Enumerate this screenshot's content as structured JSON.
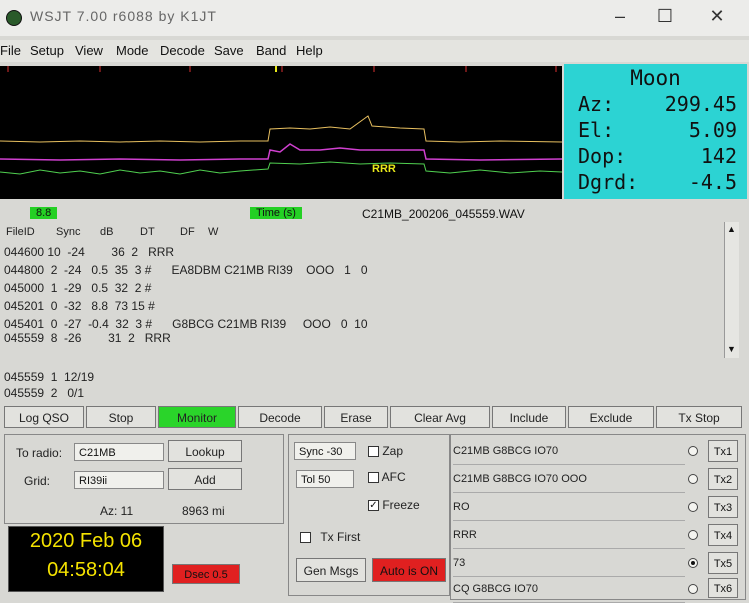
{
  "window": {
    "title": "WSJT 7.00 r6088  by K1JT",
    "buttons": [
      "–",
      "☐",
      "✕"
    ]
  },
  "menu": [
    "File",
    "Setup",
    "View",
    "Mode",
    "Decode",
    "Save",
    "Band",
    "Help"
  ],
  "waterfall": {
    "marker_text": "RRR"
  },
  "moon": {
    "title": "Moon",
    "rows": [
      {
        "label": "Az:",
        "value": "299.45"
      },
      {
        "label": "El:",
        "value": "5.09"
      },
      {
        "label": "Dop:",
        "value": "142"
      },
      {
        "label": "Dgrd:",
        "value": "-4.5"
      }
    ]
  },
  "strip": {
    "left_badge": "8.8",
    "center_badge": "Time (s)",
    "filename": "C21MB_200206_045559.WAV"
  },
  "decode": {
    "headers": [
      "FileID",
      "Sync",
      "dB",
      "DT",
      "DF",
      "W"
    ],
    "rows": [
      "044600 10  -24        36  2   RRR",
      "044800  2  -24   0.5  35  3 #      EA8DBM C21MB RI39    OOO   1   0",
      "045000  1  -29   0.5  32  2 #",
      "045201  0  -32   8.8  73 15 #",
      "045401  0  -27  -0.4  32  3 #      G8BCG C21MB RI39     OOO   0  10",
      "045559  8  -26        31  2   RRR"
    ],
    "summary": [
      "045559  1  12/19",
      "045559  2   0/1"
    ]
  },
  "buttons": [
    "Log QSO",
    "Stop",
    "Monitor",
    "Decode",
    "Erase",
    "Clear Avg",
    "Include",
    "Exclude",
    "Tx Stop"
  ],
  "station": {
    "to_radio_label": "To radio:",
    "to_radio_value": "C21MB",
    "lookup": "Lookup",
    "grid_label": "Grid:",
    "grid_value": "RI39ii",
    "add": "Add",
    "az": "Az: 11",
    "distance": "8963 mi"
  },
  "clock": {
    "date": "2020 Feb 06",
    "time": "04:58:04"
  },
  "dsec": "Dsec  0.5",
  "controls": {
    "sync_label": "Sync",
    "sync_value": "-30",
    "tol_label": "Tol",
    "tol_value": "50",
    "zap": "Zap",
    "afc": "AFC",
    "freeze": "Freeze",
    "tx_first": "Tx First",
    "gen_msgs": "Gen Msgs",
    "auto_is_on": "Auto is ON"
  },
  "messages": [
    {
      "text": "C21MB G8BCG IO70",
      "tx": "Tx1",
      "selected": false
    },
    {
      "text": "C21MB G8BCG IO70 OOO",
      "tx": "Tx2",
      "selected": false
    },
    {
      "text": "RO",
      "tx": "Tx3",
      "selected": false
    },
    {
      "text": "RRR",
      "tx": "Tx4",
      "selected": false
    },
    {
      "text": "73",
      "tx": "Tx5",
      "selected": true
    },
    {
      "text": "CQ G8BCG IO70",
      "tx": "Tx6",
      "selected": false
    }
  ],
  "colors": {
    "moon_bg": "#2cd3d3",
    "monitor_green": "#2ad42a",
    "auto_red": "#e02020",
    "clock_text": "#f5e300"
  }
}
